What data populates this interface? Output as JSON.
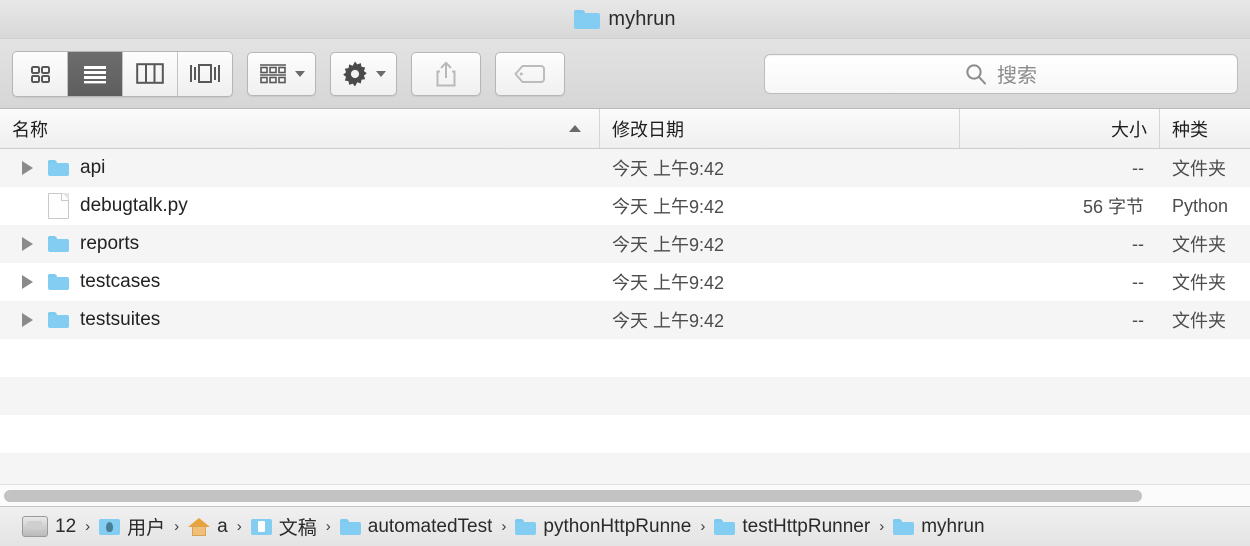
{
  "window": {
    "title": "myhrun",
    "title_icon": "folder-icon"
  },
  "toolbar": {
    "view_modes": [
      {
        "name": "icon-view",
        "icon": "grid-icon",
        "active": false
      },
      {
        "name": "list-view",
        "icon": "list-icon",
        "active": true
      },
      {
        "name": "column-view",
        "icon": "columns-icon",
        "active": false
      },
      {
        "name": "coverflow-view",
        "icon": "coverflow-icon",
        "active": false
      }
    ],
    "arrange_button": {
      "name": "arrange-button",
      "icon": "arrange-icon"
    },
    "action_button": {
      "name": "action-button",
      "icon": "gear-icon"
    },
    "share_button": {
      "name": "share-button",
      "icon": "share-icon"
    },
    "tag_button": {
      "name": "tag-button",
      "icon": "tag-icon"
    },
    "search": {
      "placeholder": "搜索",
      "value": "",
      "icon": "search-icon"
    }
  },
  "columns": {
    "name": "名称",
    "date_modified": "修改日期",
    "size": "大小",
    "kind": "种类",
    "sort_column": "名称",
    "sort_direction": "ascending"
  },
  "files": [
    {
      "name": "api",
      "icon": "folder-icon",
      "expandable": true,
      "date": "今天 上午9:42",
      "size": "--",
      "kind": "文件夹"
    },
    {
      "name": "debugtalk.py",
      "icon": "document-icon",
      "expandable": false,
      "date": "今天 上午9:42",
      "size": "56 字节",
      "kind": "Python"
    },
    {
      "name": "reports",
      "icon": "folder-icon",
      "expandable": true,
      "date": "今天 上午9:42",
      "size": "--",
      "kind": "文件夹"
    },
    {
      "name": "testcases",
      "icon": "folder-icon",
      "expandable": true,
      "date": "今天 上午9:42",
      "size": "--",
      "kind": "文件夹"
    },
    {
      "name": "testsuites",
      "icon": "folder-icon",
      "expandable": true,
      "date": "今天 上午9:42",
      "size": "--",
      "kind": "文件夹"
    }
  ],
  "path_bar": [
    {
      "label": "12",
      "icon": "disk-icon"
    },
    {
      "label": "用户",
      "icon": "users-folder-icon"
    },
    {
      "label": "a",
      "icon": "home-icon"
    },
    {
      "label": "文稿",
      "icon": "documents-folder-icon"
    },
    {
      "label": "automatedTest",
      "icon": "folder-icon"
    },
    {
      "label": "pythonHttpRunner",
      "icon": "folder-icon"
    },
    {
      "label": "testHttpRunner",
      "icon": "folder-icon"
    },
    {
      "label": "myhrun",
      "icon": "folder-icon"
    }
  ],
  "path_separator": "›",
  "colors": {
    "folder_blue": "#83cdf2",
    "row_alt": "#f5f5f5",
    "toolbar_bg": "#dcdcdc",
    "active_segment": "#5e5e5e"
  }
}
